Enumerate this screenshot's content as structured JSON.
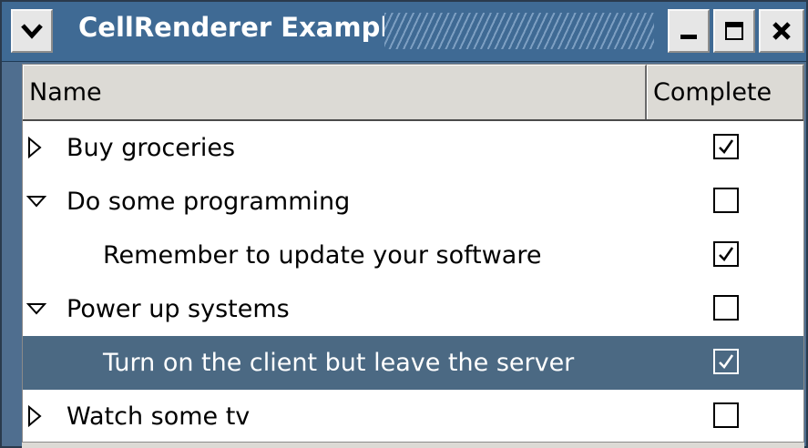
{
  "window": {
    "title": "CellRenderer Example"
  },
  "columns": [
    "Name",
    "Complete"
  ],
  "rows": [
    {
      "label": "Buy groceries",
      "level": 0,
      "expander": "collapsed",
      "complete": true,
      "selected": false
    },
    {
      "label": "Do some programming",
      "level": 0,
      "expander": "expanded",
      "complete": false,
      "selected": false
    },
    {
      "label": "Remember to update your software",
      "level": 1,
      "expander": "none",
      "complete": true,
      "selected": false
    },
    {
      "label": "Power up systems",
      "level": 0,
      "expander": "expanded",
      "complete": false,
      "selected": false
    },
    {
      "label": "Turn on the client but leave the server",
      "level": 1,
      "expander": "none",
      "complete": true,
      "selected": true
    },
    {
      "label": "Watch some tv",
      "level": 0,
      "expander": "collapsed",
      "complete": false,
      "selected": false
    }
  ],
  "colors": {
    "titlebar": "#3f6a94",
    "selection": "#4b6983",
    "window_bg": "#dcdad5"
  },
  "icons": {
    "window_menu": "chevron-down-icon",
    "minimize": "minimize-icon",
    "maximize": "maximize-icon",
    "close": "close-icon"
  }
}
